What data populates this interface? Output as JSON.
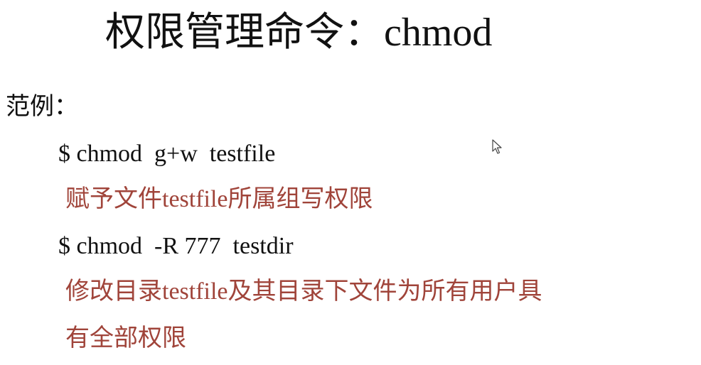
{
  "title": "权限管理命令：chmod",
  "example_label": "范例：",
  "examples": [
    {
      "command": "$ chmod  g+w  testfile",
      "description_lines": [
        "赋予文件testfile所属组写权限"
      ]
    },
    {
      "command": "$ chmod  -R 777  testdir",
      "description_lines": [
        "修改目录testfile及其目录下文件为所有用户具",
        "有全部权限"
      ]
    }
  ],
  "colors": {
    "text": "#111111",
    "description": "#a0443a",
    "background": "#ffffff"
  },
  "icons": {
    "cursor": "mouse-pointer-icon"
  }
}
